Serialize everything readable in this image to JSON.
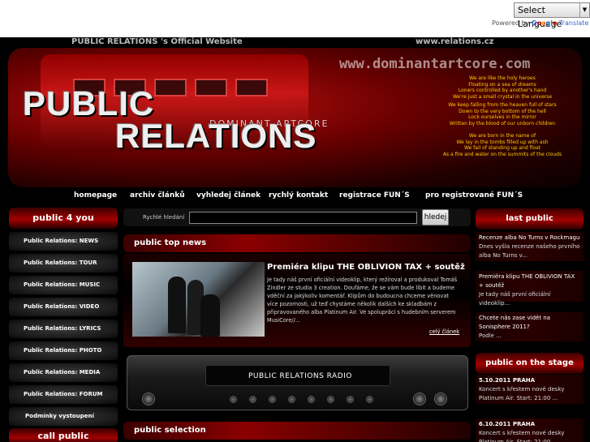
{
  "translate": {
    "select_label": "Select Language",
    "powered_by": "Powered by",
    "google": "Google",
    "translate_label": "Translate"
  },
  "header": {
    "official_site": "PUBLIC RELATIONS 's Official Website",
    "domain_small": "www.relations.cz",
    "domain_watermark": "www.dominantartcore.com",
    "logo_line1": "PUBLIC",
    "logo_line2": "RELATIONS",
    "logo_sub": "DOMINANT ARTCORE",
    "lyrics": [
      "We are like the holy heroes",
      "Floating on a sea of dreams",
      "Loners controlled by another's hand",
      "We're just a small crystal in the universe",
      "We keep falling from the heaven full of stars",
      "Down to the very bottom of the hell",
      "Lock ourselves in the mirror",
      "Written by the blood of our unborn children",
      "We are born in the name of",
      "We lay in the tombs filled up with ash",
      "We fail of standing up and float",
      "As a fire and water on the summits of the clouds"
    ]
  },
  "nav": [
    "homepage",
    "archiv článků",
    "vyhledej článek",
    "rychlý kontakt",
    "registrace FUN´S",
    "pro registrované FUN´S"
  ],
  "left": {
    "title": "public 4 you",
    "items": [
      "Public Relations: NEWS",
      "Public Relations: TOUR",
      "Public Relations: MUSIC",
      "Public Relations: VIDEO",
      "Public Relations: LYRICS",
      "Public Relations: PHOTO",
      "Public Relations: MEDIA",
      "Public Relations: FORUM",
      "Podmínky vystoupení"
    ],
    "bottom_title": "call public"
  },
  "search": {
    "label": "Rychlé hledání",
    "button": "hledej",
    "value": ""
  },
  "top_news": {
    "title": "public top news",
    "headline": "Premiéra klipu THE OBLIVION TAX + soutěž",
    "body": "Je tady náš první oficiální videoklip, který režíroval a produkoval Tomáš Zindler ze studia 3 creation. Doufáme, že se vám bude líbit a budeme vděční za jakýkoliv komentář. Klipům do budoucna chceme věnovat více pozornosti, už teď chystáme několik dalších ke skladbám z připravovaného alba Platinum Air. Ve spolupráci s hudebním serverem MusiCore//...",
    "more": "celý článek"
  },
  "radio": {
    "label": "PUBLIC RELATIONS RADIO"
  },
  "selection_title": "public selection",
  "right": {
    "last_title": "last public",
    "last_items": [
      {
        "title": "Recenze alba No Turns v Rockmagu",
        "text": "Dnes vyšla recenze našeho prvního alba No Turns v..."
      },
      {
        "title": "Premiéra klipu THE OBLIVION TAX + soutěž",
        "text": "Je tady náš první oficiální videoklip..."
      },
      {
        "title": "Chcete nás zase vidět na Sonisphere 2011?",
        "text": "Podle ..."
      }
    ],
    "stage_title": "public on the stage",
    "stage_items": [
      {
        "date": "5.10.2011 PRAHA",
        "text": "Koncert s křestem nové desky Platinum Air. Start: 21:00 ..."
      },
      {
        "date": "6.10.2011 PRAHA",
        "text": "Koncert s křestem nové desky Platinum Air. Start: 21:00 ..."
      }
    ]
  }
}
